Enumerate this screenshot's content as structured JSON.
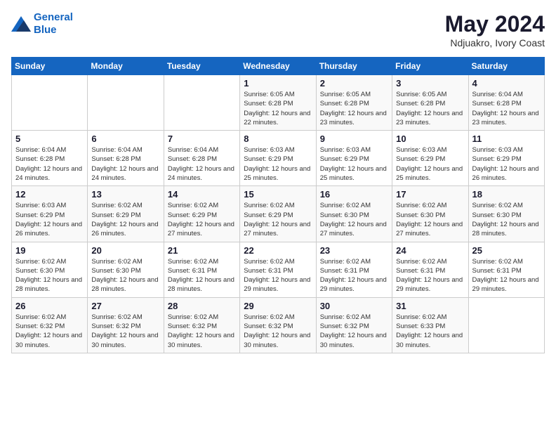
{
  "logo": {
    "line1": "General",
    "line2": "Blue"
  },
  "title": "May 2024",
  "subtitle": "Ndjuakro, Ivory Coast",
  "days_of_week": [
    "Sunday",
    "Monday",
    "Tuesday",
    "Wednesday",
    "Thursday",
    "Friday",
    "Saturday"
  ],
  "weeks": [
    [
      {
        "day": "",
        "info": ""
      },
      {
        "day": "",
        "info": ""
      },
      {
        "day": "",
        "info": ""
      },
      {
        "day": "1",
        "info": "Sunrise: 6:05 AM\nSunset: 6:28 PM\nDaylight: 12 hours\nand 22 minutes."
      },
      {
        "day": "2",
        "info": "Sunrise: 6:05 AM\nSunset: 6:28 PM\nDaylight: 12 hours\nand 23 minutes."
      },
      {
        "day": "3",
        "info": "Sunrise: 6:05 AM\nSunset: 6:28 PM\nDaylight: 12 hours\nand 23 minutes."
      },
      {
        "day": "4",
        "info": "Sunrise: 6:04 AM\nSunset: 6:28 PM\nDaylight: 12 hours\nand 23 minutes."
      }
    ],
    [
      {
        "day": "5",
        "info": "Sunrise: 6:04 AM\nSunset: 6:28 PM\nDaylight: 12 hours\nand 24 minutes."
      },
      {
        "day": "6",
        "info": "Sunrise: 6:04 AM\nSunset: 6:28 PM\nDaylight: 12 hours\nand 24 minutes."
      },
      {
        "day": "7",
        "info": "Sunrise: 6:04 AM\nSunset: 6:28 PM\nDaylight: 12 hours\nand 24 minutes."
      },
      {
        "day": "8",
        "info": "Sunrise: 6:03 AM\nSunset: 6:29 PM\nDaylight: 12 hours\nand 25 minutes."
      },
      {
        "day": "9",
        "info": "Sunrise: 6:03 AM\nSunset: 6:29 PM\nDaylight: 12 hours\nand 25 minutes."
      },
      {
        "day": "10",
        "info": "Sunrise: 6:03 AM\nSunset: 6:29 PM\nDaylight: 12 hours\nand 25 minutes."
      },
      {
        "day": "11",
        "info": "Sunrise: 6:03 AM\nSunset: 6:29 PM\nDaylight: 12 hours\nand 26 minutes."
      }
    ],
    [
      {
        "day": "12",
        "info": "Sunrise: 6:03 AM\nSunset: 6:29 PM\nDaylight: 12 hours\nand 26 minutes."
      },
      {
        "day": "13",
        "info": "Sunrise: 6:02 AM\nSunset: 6:29 PM\nDaylight: 12 hours\nand 26 minutes."
      },
      {
        "day": "14",
        "info": "Sunrise: 6:02 AM\nSunset: 6:29 PM\nDaylight: 12 hours\nand 27 minutes."
      },
      {
        "day": "15",
        "info": "Sunrise: 6:02 AM\nSunset: 6:29 PM\nDaylight: 12 hours\nand 27 minutes."
      },
      {
        "day": "16",
        "info": "Sunrise: 6:02 AM\nSunset: 6:30 PM\nDaylight: 12 hours\nand 27 minutes."
      },
      {
        "day": "17",
        "info": "Sunrise: 6:02 AM\nSunset: 6:30 PM\nDaylight: 12 hours\nand 27 minutes."
      },
      {
        "day": "18",
        "info": "Sunrise: 6:02 AM\nSunset: 6:30 PM\nDaylight: 12 hours\nand 28 minutes."
      }
    ],
    [
      {
        "day": "19",
        "info": "Sunrise: 6:02 AM\nSunset: 6:30 PM\nDaylight: 12 hours\nand 28 minutes."
      },
      {
        "day": "20",
        "info": "Sunrise: 6:02 AM\nSunset: 6:30 PM\nDaylight: 12 hours\nand 28 minutes."
      },
      {
        "day": "21",
        "info": "Sunrise: 6:02 AM\nSunset: 6:31 PM\nDaylight: 12 hours\nand 28 minutes."
      },
      {
        "day": "22",
        "info": "Sunrise: 6:02 AM\nSunset: 6:31 PM\nDaylight: 12 hours\nand 29 minutes."
      },
      {
        "day": "23",
        "info": "Sunrise: 6:02 AM\nSunset: 6:31 PM\nDaylight: 12 hours\nand 29 minutes."
      },
      {
        "day": "24",
        "info": "Sunrise: 6:02 AM\nSunset: 6:31 PM\nDaylight: 12 hours\nand 29 minutes."
      },
      {
        "day": "25",
        "info": "Sunrise: 6:02 AM\nSunset: 6:31 PM\nDaylight: 12 hours\nand 29 minutes."
      }
    ],
    [
      {
        "day": "26",
        "info": "Sunrise: 6:02 AM\nSunset: 6:32 PM\nDaylight: 12 hours\nand 30 minutes."
      },
      {
        "day": "27",
        "info": "Sunrise: 6:02 AM\nSunset: 6:32 PM\nDaylight: 12 hours\nand 30 minutes."
      },
      {
        "day": "28",
        "info": "Sunrise: 6:02 AM\nSunset: 6:32 PM\nDaylight: 12 hours\nand 30 minutes."
      },
      {
        "day": "29",
        "info": "Sunrise: 6:02 AM\nSunset: 6:32 PM\nDaylight: 12 hours\nand 30 minutes."
      },
      {
        "day": "30",
        "info": "Sunrise: 6:02 AM\nSunset: 6:32 PM\nDaylight: 12 hours\nand 30 minutes."
      },
      {
        "day": "31",
        "info": "Sunrise: 6:02 AM\nSunset: 6:33 PM\nDaylight: 12 hours\nand 30 minutes."
      },
      {
        "day": "",
        "info": ""
      }
    ]
  ]
}
